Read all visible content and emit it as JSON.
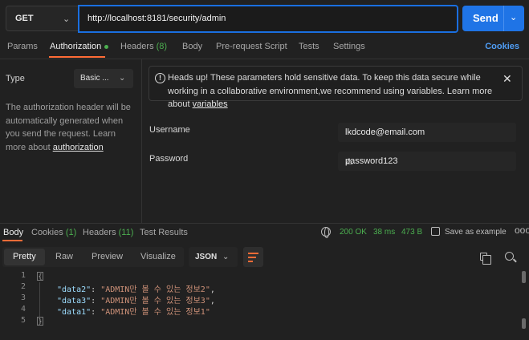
{
  "request": {
    "method": "GET",
    "url": "http://localhost:8181/security/admin",
    "send_label": "Send"
  },
  "request_tabs": [
    {
      "label": "Params"
    },
    {
      "label": "Authorization"
    },
    {
      "label": "Headers",
      "count": "(8)"
    },
    {
      "label": "Body"
    },
    {
      "label": "Pre-request Script"
    },
    {
      "label": "Tests"
    },
    {
      "label": "Settings"
    }
  ],
  "cookies_link": "Cookies",
  "auth": {
    "type_label": "Type",
    "type_value": "Basic ...",
    "description": "The authorization header will be automatically generated when you send the request. Learn more about ",
    "description_link": "authorization",
    "notice_text": "Heads up! These parameters hold sensitive data. To keep this data secure while working in a collaborative environment,we recommend using variables. Learn more about ",
    "notice_link": "variables",
    "username_label": "Username",
    "username_value": "lkdcode@email.com",
    "password_label": "Password",
    "password_value": "password123"
  },
  "response_tabs": [
    {
      "label": "Body"
    },
    {
      "label": "Cookies",
      "count": "(1)"
    },
    {
      "label": "Headers",
      "count": "(11)"
    },
    {
      "label": "Test Results"
    }
  ],
  "response_status": {
    "status": "200 OK",
    "time": "38 ms",
    "size": "473 B",
    "save_label": "Save as example",
    "more": "ooo"
  },
  "view_tabs": [
    "Pretty",
    "Raw",
    "Preview",
    "Visualize"
  ],
  "format": "JSON",
  "code_lines": [
    {
      "n": "1",
      "key": "",
      "value": "",
      "text": "{"
    },
    {
      "n": "2",
      "key": "\"data2\"",
      "value": "\"ADMIN만 볼 수 있는 정보2\"",
      "text": ","
    },
    {
      "n": "3",
      "key": "\"data3\"",
      "value": "\"ADMIN만 볼 수 있는 정보3\"",
      "text": ","
    },
    {
      "n": "4",
      "key": "\"data1\"",
      "value": "\"ADMIN만 볼 수 있는 정보1\"",
      "text": ""
    },
    {
      "n": "5",
      "key": "",
      "value": "",
      "text": "}"
    }
  ],
  "colors": {
    "accent": "#ff6c37",
    "send_button": "#1f74e6",
    "status_ok": "#4caf50",
    "url_focus": "#1a6fe0"
  },
  "icons": [
    "chevron-down-icon",
    "info-icon",
    "close-icon",
    "warning-icon",
    "globe-icon",
    "save-icon",
    "more-icon",
    "wrap-lines-icon",
    "copy-icon",
    "search-icon"
  ]
}
